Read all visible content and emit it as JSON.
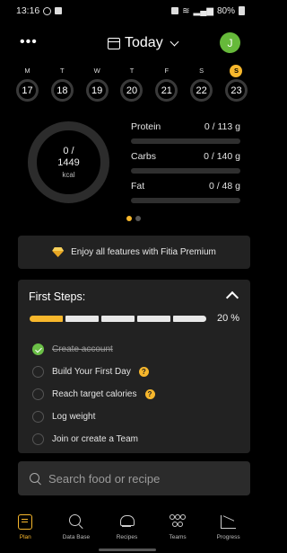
{
  "status_bar": {
    "time": "13:16",
    "battery": "80%"
  },
  "header": {
    "title": "Today",
    "more_icon": "more-icon",
    "avatar_initial": "J"
  },
  "week": {
    "day_letters": [
      "M",
      "T",
      "W",
      "T",
      "F",
      "S",
      "S"
    ],
    "day_numbers": [
      "17",
      "18",
      "19",
      "20",
      "21",
      "22",
      "23"
    ],
    "today_index": 6
  },
  "calories": {
    "consumed_label": "0 /",
    "target": "1449",
    "unit": "kcal"
  },
  "macros": [
    {
      "name": "Protein",
      "value": "0 / 113 g",
      "fraction": 0
    },
    {
      "name": "Carbs",
      "value": "0 / 140 g",
      "fraction": 0
    },
    {
      "name": "Fat",
      "value": "0 / 48 g",
      "fraction": 0
    }
  ],
  "carousel": {
    "pages": 2,
    "active": 0
  },
  "premium": {
    "label": "Enjoy all features with Fitia Premium"
  },
  "first_steps": {
    "title": "First Steps:",
    "progress_pct": "20 %",
    "progress_fraction": 0.2,
    "segments": 5,
    "completed_segments": 1,
    "items": [
      {
        "label": "Create account",
        "done": true,
        "badge": ""
      },
      {
        "label": "Build Your First Day",
        "done": false,
        "badge": "?"
      },
      {
        "label": "Reach target calories",
        "done": false,
        "badge": "?"
      },
      {
        "label": "Log weight",
        "done": false,
        "badge": ""
      },
      {
        "label": "Join or create a Team",
        "done": false,
        "badge": ""
      }
    ]
  },
  "search": {
    "placeholder": "Search food or recipe"
  },
  "nav": {
    "items": [
      {
        "label": "Plan",
        "icon": "plan-icon",
        "active": true
      },
      {
        "label": "Data Base",
        "icon": "search-icon",
        "active": false
      },
      {
        "label": "Recipes",
        "icon": "chef-hat-icon",
        "active": false
      },
      {
        "label": "Teams",
        "icon": "team-icon",
        "active": false
      },
      {
        "label": "Progress",
        "icon": "chart-icon",
        "active": false
      }
    ]
  },
  "colors": {
    "accent": "#f7b72c",
    "success": "#6bbf47",
    "avatar": "#66b93a",
    "card": "#222222"
  }
}
